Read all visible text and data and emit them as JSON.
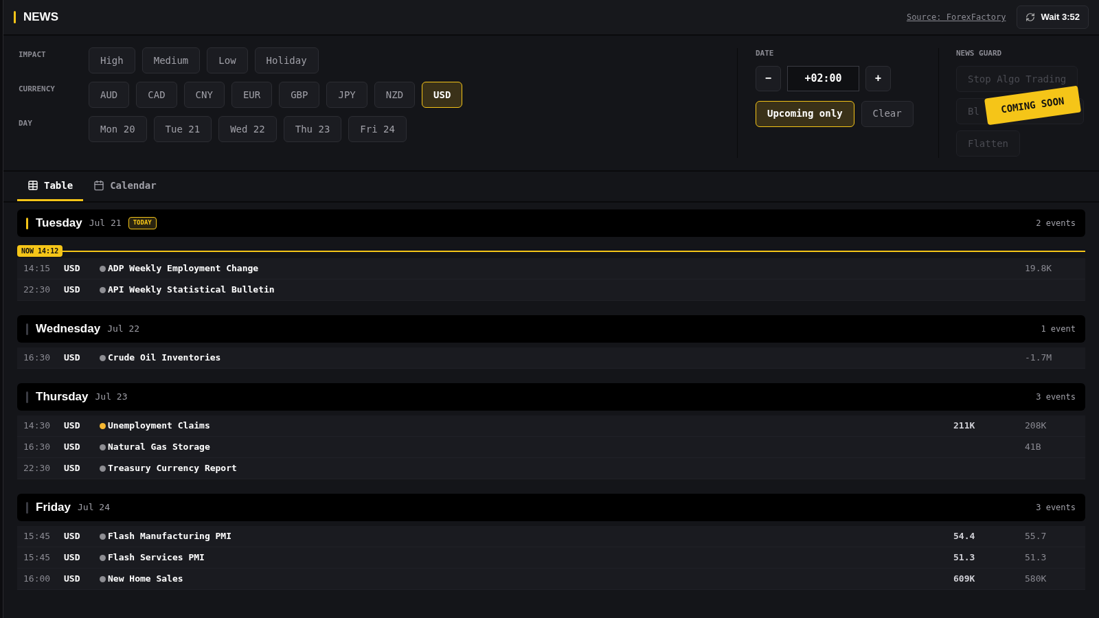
{
  "header": {
    "title": "NEWS",
    "source_link": "Source: ForexFactory",
    "refresh_button": "Wait 3:52"
  },
  "filters": {
    "impact": {
      "label": "IMPACT",
      "options": [
        {
          "label": "High",
          "selected": false
        },
        {
          "label": "Medium",
          "selected": false
        },
        {
          "label": "Low",
          "selected": false
        },
        {
          "label": "Holiday",
          "selected": false
        }
      ]
    },
    "currency": {
      "label": "CURRENCY",
      "options": [
        {
          "label": "AUD",
          "selected": false
        },
        {
          "label": "CAD",
          "selected": false
        },
        {
          "label": "CNY",
          "selected": false
        },
        {
          "label": "EUR",
          "selected": false
        },
        {
          "label": "GBP",
          "selected": false
        },
        {
          "label": "JPY",
          "selected": false
        },
        {
          "label": "NZD",
          "selected": false
        },
        {
          "label": "USD",
          "selected": true
        }
      ]
    },
    "day": {
      "label": "DAY",
      "options": [
        {
          "label": "Mon 20",
          "selected": false
        },
        {
          "label": "Tue 21",
          "selected": false
        },
        {
          "label": "Wed 22",
          "selected": false
        },
        {
          "label": "Thu 23",
          "selected": false
        },
        {
          "label": "Fri 24",
          "selected": false
        }
      ]
    }
  },
  "date": {
    "label": "DATE",
    "minus": "−",
    "offset": "+02:00",
    "plus": "+",
    "upcoming_only": {
      "label": "Upcoming only",
      "selected": true
    },
    "clear": "Clear"
  },
  "news_guard": {
    "label": "NEWS GUARD",
    "buttons": [
      {
        "parts": [
          "Stop Algo Trading"
        ],
        "covered": false
      },
      {
        "parts": [
          "Bl"
        ],
        "covered": true
      },
      {
        "parts": [
          "Flatten"
        ],
        "covered": false
      }
    ],
    "banner": "COMING SOON"
  },
  "tabs": [
    {
      "label": "Table",
      "kind": "table",
      "selected": true
    },
    {
      "label": "Calendar",
      "kind": "calendar",
      "selected": false
    }
  ],
  "days": [
    {
      "name": "Tuesday",
      "date": "Jul 21",
      "today": true,
      "badge": "TODAY",
      "count": "2 events",
      "now_marker": "NOW 14:12",
      "events": [
        {
          "time": "14:15",
          "currency": "USD",
          "color": "#8e8e93",
          "title": "ADP Weekly Employment Change",
          "forecast": "19.8K"
        },
        {
          "time": "22:30",
          "currency": "USD",
          "color": "#8e8e93",
          "title": "API Weekly Statistical Bulletin"
        }
      ]
    },
    {
      "name": "Wednesday",
      "date": "Jul 22",
      "today": false,
      "count": "1 event",
      "events": [
        {
          "time": "16:30",
          "currency": "USD",
          "color": "#8e8e93",
          "title": "Crude Oil Inventories",
          "forecast": "-1.7M"
        }
      ]
    },
    {
      "name": "Thursday",
      "date": "Jul 23",
      "today": false,
      "count": "3 events",
      "events": [
        {
          "time": "14:30",
          "currency": "USD",
          "color": "#f5b731",
          "title": "Unemployment Claims",
          "actual": "211K",
          "forecast": "208K"
        },
        {
          "time": "16:30",
          "currency": "USD",
          "color": "#8e8e93",
          "title": "Natural Gas Storage",
          "forecast": "41B"
        },
        {
          "time": "22:30",
          "currency": "USD",
          "color": "#8e8e93",
          "title": "Treasury Currency Report"
        }
      ]
    },
    {
      "name": "Friday",
      "date": "Jul 24",
      "today": false,
      "count": "3 events",
      "events": [
        {
          "time": "15:45",
          "currency": "USD",
          "color": "#8e8e93",
          "title": "Flash Manufacturing PMI",
          "actual": "54.4",
          "forecast": "55.7"
        },
        {
          "time": "15:45",
          "currency": "USD",
          "color": "#8e8e93",
          "title": "Flash Services PMI",
          "actual": "51.3",
          "forecast": "51.3"
        },
        {
          "time": "16:00",
          "currency": "USD",
          "color": "#8e8e93",
          "title": "New Home Sales",
          "actual": "609K",
          "forecast": "580K"
        }
      ]
    }
  ]
}
